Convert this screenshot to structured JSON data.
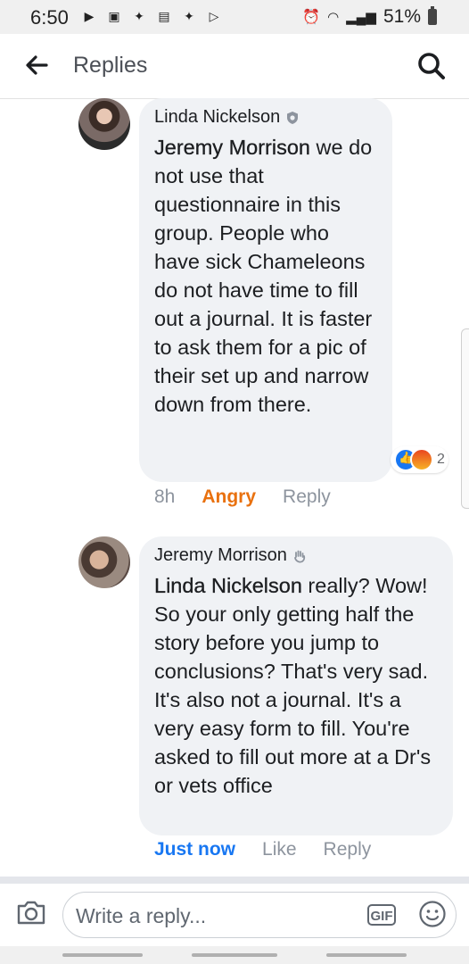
{
  "status_bar": {
    "time": "6:50",
    "battery": "51%"
  },
  "header": {
    "title": "Replies"
  },
  "comments": [
    {
      "author": "Linda Nickelson",
      "mention": "Jeremy Morrison",
      "text": " we do not use that questionnaire in this group. People who have sick Chameleons do not have time to fill out a journal. It is faster to ask them for a pic of their set up and narrow down from there.",
      "reaction_count": "2",
      "time": "8h",
      "reaction_label": "Angry",
      "reply_label": "Reply"
    },
    {
      "author": "Jeremy Morrison",
      "mention": "Linda Nickelson",
      "text": " really? Wow! So your only getting half the story before you jump to conclusions? That's very sad. It's also not a journal. It's a very easy form to fill. You're asked to fill out more at a Dr's or vets office",
      "time": "Just now",
      "like_label": "Like",
      "reply_label": "Reply"
    }
  ],
  "composer": {
    "placeholder": "Write a reply...",
    "gif_label": "GIF"
  },
  "colors": {
    "link_blue": "#1877f2",
    "angry_orange": "#e9710f",
    "bubble_bg": "#f0f2f5"
  }
}
